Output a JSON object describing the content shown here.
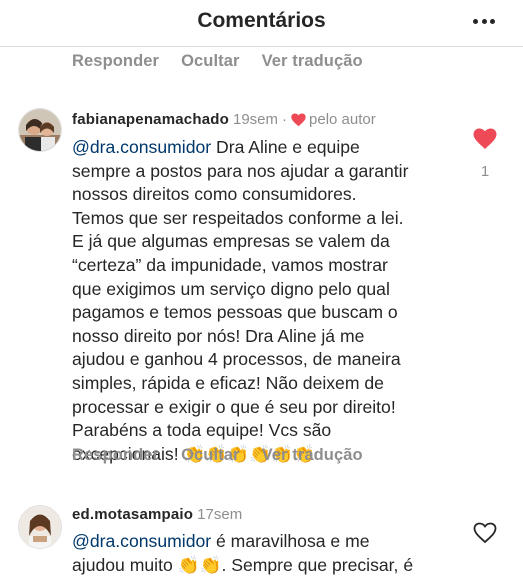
{
  "header": {
    "title": "Comentários"
  },
  "actions": {
    "reply": "Responder",
    "hide": "Ocultar",
    "translate": "Ver tradução"
  },
  "comments": [
    {
      "username": "fabianapenamachado",
      "time": "19sem",
      "liked_by_author_separator": "·",
      "liked_by_author": "pelo autor",
      "mention": "@dra.consumidor",
      "lines": [
        " Dra Aline e equipe",
        "sempre a postos para nos ajudar a garantir",
        "nossos direitos como consumidores.",
        "Temos que ser respeitados conforme a lei.",
        "E já que algumas empresas se valem da",
        "“certeza” da impunidade, vamos mostrar",
        "que exigimos um serviço digno pelo qual",
        "pagamos e temos pessoas que buscam o",
        "nosso direito por nós! Dra Aline já me",
        "ajudou e ganhou 4 processos, de maneira",
        "simples, rápida e eficaz! Não deixem de",
        "processar e exigir o que é seu por direito!",
        "Parabéns a toda equipe! Vcs são",
        "excepcionais! 👏👏👏👏👏👏"
      ],
      "likes": "1",
      "heart_color": "#ed4956"
    },
    {
      "username": "ed.motasampaio",
      "time": "17sem",
      "mention": "@dra.consumidor",
      "first_line": " é maravilhosa e me",
      "second_line": "ajudou muito 👏👏. Sempre que precisar, é"
    }
  ]
}
